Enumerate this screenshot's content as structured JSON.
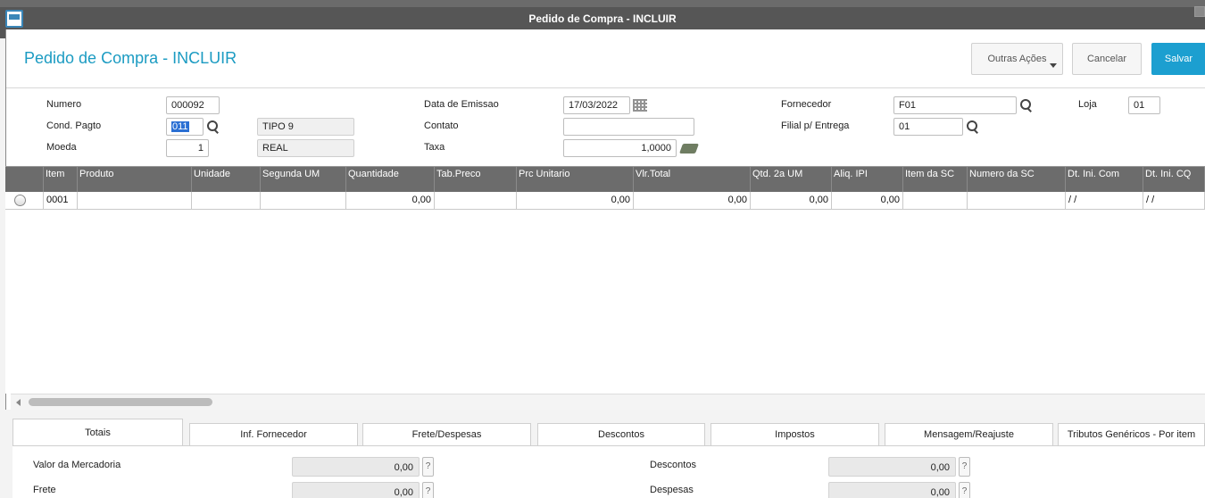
{
  "window": {
    "title": "Pedido de Compra - INCLUIR"
  },
  "header": {
    "title": "Pedido de Compra - INCLUIR",
    "btn_outras": "Outras Ações",
    "btn_cancelar": "Cancelar",
    "btn_salvar": "Salvar"
  },
  "form": {
    "numero_label": "Numero",
    "numero_value": "000092",
    "cond_label": "Cond. Pagto",
    "cond_value": "011",
    "cond_desc": "TIPO 9",
    "moeda_label": "Moeda",
    "moeda_value": "1",
    "moeda_desc": "REAL",
    "data_label": "Data de Emissao",
    "data_value": "17/03/2022",
    "contato_label": "Contato",
    "contato_value": "",
    "taxa_label": "Taxa",
    "taxa_value": "1,0000",
    "fornecedor_label": "Fornecedor",
    "fornecedor_value": "F01",
    "loja_label": "Loja",
    "loja_value": "01",
    "filial_label": "Filial p/ Entrega",
    "filial_value": "01"
  },
  "grid": {
    "columns": [
      "Item",
      "Produto",
      "Unidade",
      "Segunda UM",
      "Quantidade",
      "Tab.Preco",
      "Prc Unitario",
      "Vlr.Total",
      "Qtd. 2a UM",
      "Aliq. IPI",
      "Item da SC",
      "Numero da SC",
      "Dt. Ini. Com",
      "Dt. Ini. CQ"
    ],
    "row": [
      "0001",
      "",
      "",
      "",
      "0,00",
      "",
      "0,00",
      "0,00",
      "0,00",
      "0,00",
      "",
      "",
      " /  /",
      " /  /"
    ]
  },
  "tabs": [
    "Totais",
    "Inf. Fornecedor",
    "Frete/Despesas",
    "Descontos",
    "Impostos",
    "Mensagem/Reajuste",
    "Tributos Genéricos - Por item"
  ],
  "totais": {
    "valor_label": "Valor da Mercadoria",
    "valor_value": "0,00",
    "frete_label": "Frete",
    "frete_value": "0,00",
    "descontos_label": "Descontos",
    "descontos_value": "0,00",
    "despesas_label": "Despesas",
    "despesas_value": "0,00",
    "help": "?"
  }
}
